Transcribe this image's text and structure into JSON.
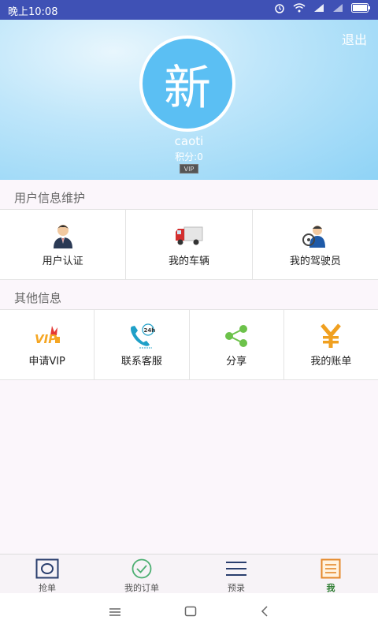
{
  "status_bar": {
    "time": "晚上10:08"
  },
  "header": {
    "logout_label": "退出",
    "avatar_text": "新",
    "username": "caoti",
    "points": "积分:0",
    "vip_badge": "VIP"
  },
  "section_user": {
    "title": "用户信息维护",
    "items": [
      {
        "label": "用户认证",
        "icon": "person-icon"
      },
      {
        "label": "我的车辆",
        "icon": "truck-icon"
      },
      {
        "label": "我的驾驶员",
        "icon": "driver-icon"
      }
    ]
  },
  "section_other": {
    "title": "其他信息",
    "items": [
      {
        "label": "申请VIP",
        "icon": "vip-icon"
      },
      {
        "label": "联系客服",
        "icon": "phone-24h-icon"
      },
      {
        "label": "分享",
        "icon": "share-icon"
      },
      {
        "label": "我的账单",
        "icon": "yen-icon"
      }
    ]
  },
  "bottom_nav": {
    "items": [
      {
        "label": "抢单",
        "icon": "grab-order-icon"
      },
      {
        "label": "我的订单",
        "icon": "check-circle-icon"
      },
      {
        "label": "预录",
        "icon": "list-icon"
      },
      {
        "label": "我",
        "icon": "me-icon",
        "active": true
      }
    ]
  },
  "colors": {
    "status_bar": "#3f51b5",
    "avatar_bg": "#5bbff3",
    "active_nav": "#2e7d32"
  }
}
